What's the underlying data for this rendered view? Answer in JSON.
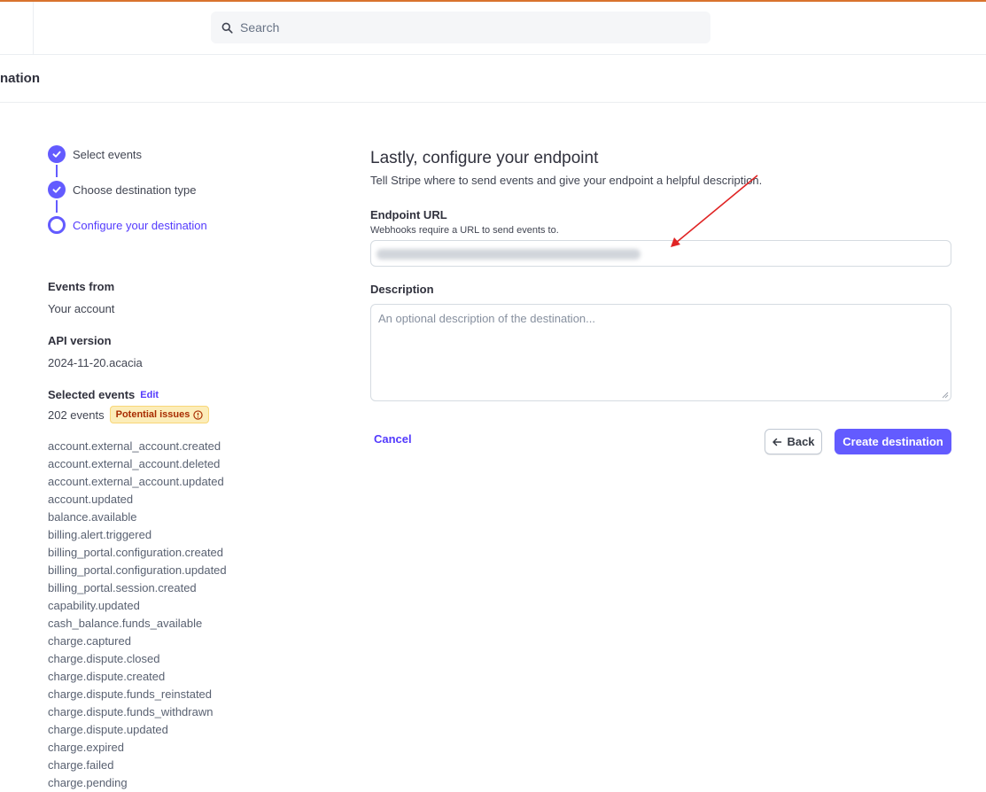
{
  "header": {
    "search_placeholder": "Search",
    "page_title": "nation"
  },
  "steps": [
    {
      "label": "Select events",
      "state": "done"
    },
    {
      "label": "Choose destination type",
      "state": "done"
    },
    {
      "label": "Configure your destination",
      "state": "current"
    }
  ],
  "summary": {
    "events_from_label": "Events from",
    "events_from_value": "Your account",
    "api_version_label": "API version",
    "api_version_value": "2024-11-20.acacia",
    "selected_events_label": "Selected events",
    "edit_label": "Edit",
    "events_count": "202 events",
    "issues_badge": "Potential issues"
  },
  "events": [
    "account.external_account.created",
    "account.external_account.deleted",
    "account.external_account.updated",
    "account.updated",
    "balance.available",
    "billing.alert.triggered",
    "billing_portal.configuration.created",
    "billing_portal.configuration.updated",
    "billing_portal.session.created",
    "capability.updated",
    "cash_balance.funds_available",
    "charge.captured",
    "charge.dispute.closed",
    "charge.dispute.created",
    "charge.dispute.funds_reinstated",
    "charge.dispute.funds_withdrawn",
    "charge.dispute.updated",
    "charge.expired",
    "charge.failed",
    "charge.pending"
  ],
  "form": {
    "heading": "Lastly, configure your endpoint",
    "subtitle": "Tell Stripe where to send events and give your endpoint a helpful description.",
    "endpoint_label": "Endpoint URL",
    "endpoint_help": "Webhooks require a URL to send events to.",
    "description_label": "Description",
    "description_placeholder": "An optional description of the destination..."
  },
  "actions": {
    "cancel": "Cancel",
    "back": "Back",
    "create": "Create destination"
  },
  "colors": {
    "accent": "#635bff",
    "annotation_arrow": "#e02424"
  }
}
